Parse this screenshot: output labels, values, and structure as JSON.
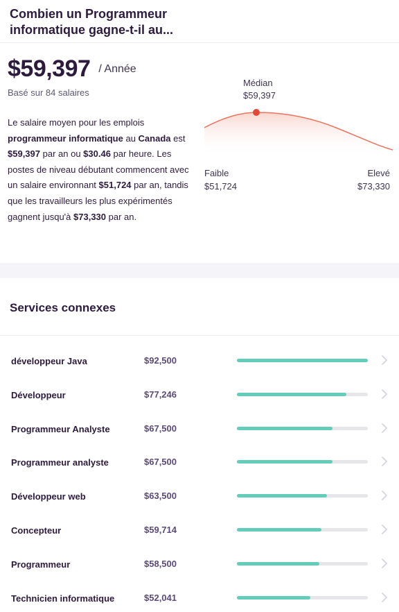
{
  "header": {
    "title": "Combien un Programmeur informatique gagne-t-il au..."
  },
  "salary": {
    "amount": "$59,397",
    "period": "/ Année",
    "based_on": "Basé sur 84 salaires"
  },
  "description": {
    "p1": "Le salaire moyen pour les emplois ",
    "job": "programmeur informatique",
    "p2": " au ",
    "country": "Canada",
    "p3": " est ",
    "yearly": "$59,397",
    "p4": " par an ou ",
    "hourly": "$30.46",
    "p5": " par heure. Les postes de niveau débutant commencent avec un salaire environnant ",
    "entry": "$51,724",
    "p6": " par an, tandis que les travailleurs les plus expérimentés gagnent jusqu'à ",
    "senior": "$73,330",
    "p7": " par an."
  },
  "distribution": {
    "median_label": "Médian",
    "median_value": "$59,397",
    "low_label": "Faible",
    "low_value": "$51,724",
    "high_label": "Elevé",
    "high_value": "$73,330",
    "curve_color": "#e8745e",
    "marker_color": "#e04a35"
  },
  "services": {
    "title": "Services connexes",
    "bar_color": "#63cdb9",
    "items": [
      {
        "name": "développeur Java",
        "salary": "$92,500",
        "fraction": 1.0
      },
      {
        "name": "Développeur",
        "salary": "$77,246",
        "fraction": 0.835
      },
      {
        "name": "Programmeur Analyste",
        "salary": "$67,500",
        "fraction": 0.73
      },
      {
        "name": "Programmeur analyste",
        "salary": "$67,500",
        "fraction": 0.73
      },
      {
        "name": "Développeur web",
        "salary": "$63,500",
        "fraction": 0.686
      },
      {
        "name": "Concepteur",
        "salary": "$59,714",
        "fraction": 0.646
      },
      {
        "name": "Programmeur",
        "salary": "$58,500",
        "fraction": 0.632
      },
      {
        "name": "Technicien informatique",
        "salary": "$52,041",
        "fraction": 0.563
      }
    ]
  }
}
